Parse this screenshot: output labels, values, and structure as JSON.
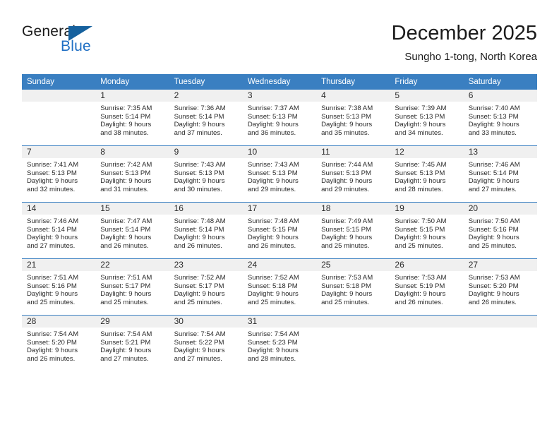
{
  "brand": {
    "line1": "General",
    "line2": "Blue",
    "accent_color": "#1f6fc4",
    "flag_color": "#16619e",
    "flag_icon": "triangle-flag-icon"
  },
  "header": {
    "month_title": "December 2025",
    "location": "Sungho 1-tong, North Korea"
  },
  "theme": {
    "header_bg": "#3a7fc1",
    "header_text": "#ffffff",
    "daynum_band_bg": "#f0f0f0",
    "cell_bg": "#ffffff",
    "row_divider": "#3a7fc1"
  },
  "weekdays": [
    "Sunday",
    "Monday",
    "Tuesday",
    "Wednesday",
    "Thursday",
    "Friday",
    "Saturday"
  ],
  "weeks": [
    [
      {
        "day": "",
        "blank": true,
        "sunrise": "",
        "sunset": "",
        "daylight1": "",
        "daylight2": ""
      },
      {
        "day": "1",
        "blank": false,
        "sunrise": "Sunrise: 7:35 AM",
        "sunset": "Sunset: 5:14 PM",
        "daylight1": "Daylight: 9 hours",
        "daylight2": "and 38 minutes."
      },
      {
        "day": "2",
        "blank": false,
        "sunrise": "Sunrise: 7:36 AM",
        "sunset": "Sunset: 5:14 PM",
        "daylight1": "Daylight: 9 hours",
        "daylight2": "and 37 minutes."
      },
      {
        "day": "3",
        "blank": false,
        "sunrise": "Sunrise: 7:37 AM",
        "sunset": "Sunset: 5:13 PM",
        "daylight1": "Daylight: 9 hours",
        "daylight2": "and 36 minutes."
      },
      {
        "day": "4",
        "blank": false,
        "sunrise": "Sunrise: 7:38 AM",
        "sunset": "Sunset: 5:13 PM",
        "daylight1": "Daylight: 9 hours",
        "daylight2": "and 35 minutes."
      },
      {
        "day": "5",
        "blank": false,
        "sunrise": "Sunrise: 7:39 AM",
        "sunset": "Sunset: 5:13 PM",
        "daylight1": "Daylight: 9 hours",
        "daylight2": "and 34 minutes."
      },
      {
        "day": "6",
        "blank": false,
        "sunrise": "Sunrise: 7:40 AM",
        "sunset": "Sunset: 5:13 PM",
        "daylight1": "Daylight: 9 hours",
        "daylight2": "and 33 minutes."
      }
    ],
    [
      {
        "day": "7",
        "blank": false,
        "sunrise": "Sunrise: 7:41 AM",
        "sunset": "Sunset: 5:13 PM",
        "daylight1": "Daylight: 9 hours",
        "daylight2": "and 32 minutes."
      },
      {
        "day": "8",
        "blank": false,
        "sunrise": "Sunrise: 7:42 AM",
        "sunset": "Sunset: 5:13 PM",
        "daylight1": "Daylight: 9 hours",
        "daylight2": "and 31 minutes."
      },
      {
        "day": "9",
        "blank": false,
        "sunrise": "Sunrise: 7:43 AM",
        "sunset": "Sunset: 5:13 PM",
        "daylight1": "Daylight: 9 hours",
        "daylight2": "and 30 minutes."
      },
      {
        "day": "10",
        "blank": false,
        "sunrise": "Sunrise: 7:43 AM",
        "sunset": "Sunset: 5:13 PM",
        "daylight1": "Daylight: 9 hours",
        "daylight2": "and 29 minutes."
      },
      {
        "day": "11",
        "blank": false,
        "sunrise": "Sunrise: 7:44 AM",
        "sunset": "Sunset: 5:13 PM",
        "daylight1": "Daylight: 9 hours",
        "daylight2": "and 29 minutes."
      },
      {
        "day": "12",
        "blank": false,
        "sunrise": "Sunrise: 7:45 AM",
        "sunset": "Sunset: 5:13 PM",
        "daylight1": "Daylight: 9 hours",
        "daylight2": "and 28 minutes."
      },
      {
        "day": "13",
        "blank": false,
        "sunrise": "Sunrise: 7:46 AM",
        "sunset": "Sunset: 5:14 PM",
        "daylight1": "Daylight: 9 hours",
        "daylight2": "and 27 minutes."
      }
    ],
    [
      {
        "day": "14",
        "blank": false,
        "sunrise": "Sunrise: 7:46 AM",
        "sunset": "Sunset: 5:14 PM",
        "daylight1": "Daylight: 9 hours",
        "daylight2": "and 27 minutes."
      },
      {
        "day": "15",
        "blank": false,
        "sunrise": "Sunrise: 7:47 AM",
        "sunset": "Sunset: 5:14 PM",
        "daylight1": "Daylight: 9 hours",
        "daylight2": "and 26 minutes."
      },
      {
        "day": "16",
        "blank": false,
        "sunrise": "Sunrise: 7:48 AM",
        "sunset": "Sunset: 5:14 PM",
        "daylight1": "Daylight: 9 hours",
        "daylight2": "and 26 minutes."
      },
      {
        "day": "17",
        "blank": false,
        "sunrise": "Sunrise: 7:48 AM",
        "sunset": "Sunset: 5:15 PM",
        "daylight1": "Daylight: 9 hours",
        "daylight2": "and 26 minutes."
      },
      {
        "day": "18",
        "blank": false,
        "sunrise": "Sunrise: 7:49 AM",
        "sunset": "Sunset: 5:15 PM",
        "daylight1": "Daylight: 9 hours",
        "daylight2": "and 25 minutes."
      },
      {
        "day": "19",
        "blank": false,
        "sunrise": "Sunrise: 7:50 AM",
        "sunset": "Sunset: 5:15 PM",
        "daylight1": "Daylight: 9 hours",
        "daylight2": "and 25 minutes."
      },
      {
        "day": "20",
        "blank": false,
        "sunrise": "Sunrise: 7:50 AM",
        "sunset": "Sunset: 5:16 PM",
        "daylight1": "Daylight: 9 hours",
        "daylight2": "and 25 minutes."
      }
    ],
    [
      {
        "day": "21",
        "blank": false,
        "sunrise": "Sunrise: 7:51 AM",
        "sunset": "Sunset: 5:16 PM",
        "daylight1": "Daylight: 9 hours",
        "daylight2": "and 25 minutes."
      },
      {
        "day": "22",
        "blank": false,
        "sunrise": "Sunrise: 7:51 AM",
        "sunset": "Sunset: 5:17 PM",
        "daylight1": "Daylight: 9 hours",
        "daylight2": "and 25 minutes."
      },
      {
        "day": "23",
        "blank": false,
        "sunrise": "Sunrise: 7:52 AM",
        "sunset": "Sunset: 5:17 PM",
        "daylight1": "Daylight: 9 hours",
        "daylight2": "and 25 minutes."
      },
      {
        "day": "24",
        "blank": false,
        "sunrise": "Sunrise: 7:52 AM",
        "sunset": "Sunset: 5:18 PM",
        "daylight1": "Daylight: 9 hours",
        "daylight2": "and 25 minutes."
      },
      {
        "day": "25",
        "blank": false,
        "sunrise": "Sunrise: 7:53 AM",
        "sunset": "Sunset: 5:18 PM",
        "daylight1": "Daylight: 9 hours",
        "daylight2": "and 25 minutes."
      },
      {
        "day": "26",
        "blank": false,
        "sunrise": "Sunrise: 7:53 AM",
        "sunset": "Sunset: 5:19 PM",
        "daylight1": "Daylight: 9 hours",
        "daylight2": "and 26 minutes."
      },
      {
        "day": "27",
        "blank": false,
        "sunrise": "Sunrise: 7:53 AM",
        "sunset": "Sunset: 5:20 PM",
        "daylight1": "Daylight: 9 hours",
        "daylight2": "and 26 minutes."
      }
    ],
    [
      {
        "day": "28",
        "blank": false,
        "sunrise": "Sunrise: 7:54 AM",
        "sunset": "Sunset: 5:20 PM",
        "daylight1": "Daylight: 9 hours",
        "daylight2": "and 26 minutes."
      },
      {
        "day": "29",
        "blank": false,
        "sunrise": "Sunrise: 7:54 AM",
        "sunset": "Sunset: 5:21 PM",
        "daylight1": "Daylight: 9 hours",
        "daylight2": "and 27 minutes."
      },
      {
        "day": "30",
        "blank": false,
        "sunrise": "Sunrise: 7:54 AM",
        "sunset": "Sunset: 5:22 PM",
        "daylight1": "Daylight: 9 hours",
        "daylight2": "and 27 minutes."
      },
      {
        "day": "31",
        "blank": false,
        "sunrise": "Sunrise: 7:54 AM",
        "sunset": "Sunset: 5:23 PM",
        "daylight1": "Daylight: 9 hours",
        "daylight2": "and 28 minutes."
      },
      {
        "day": "",
        "blank": true,
        "sunrise": "",
        "sunset": "",
        "daylight1": "",
        "daylight2": ""
      },
      {
        "day": "",
        "blank": true,
        "sunrise": "",
        "sunset": "",
        "daylight1": "",
        "daylight2": ""
      },
      {
        "day": "",
        "blank": true,
        "sunrise": "",
        "sunset": "",
        "daylight1": "",
        "daylight2": ""
      }
    ]
  ]
}
